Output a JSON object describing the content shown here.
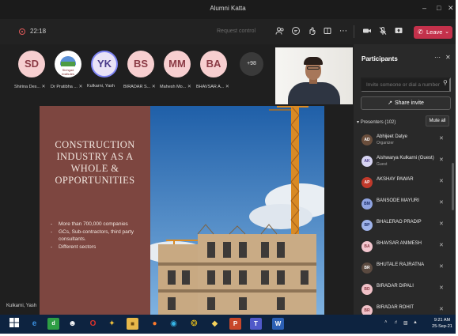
{
  "window": {
    "title": "Alumni Katta"
  },
  "toolbar": {
    "timer": "22:18",
    "request_control": "Request control",
    "leave_label": "Leave"
  },
  "strip": {
    "tiles": [
      {
        "initials": "SD",
        "name": "Shirina Des..."
      },
      {
        "initials": "",
        "logo_text": "Sinhgad Institutes",
        "name": "Dr Pratibha ..."
      },
      {
        "initials": "YK",
        "name": "Kulkarni, Yash"
      },
      {
        "initials": "BS",
        "name": "BIRADAR S..."
      },
      {
        "initials": "MM",
        "name": "Mahesh Mo..."
      },
      {
        "initials": "BA",
        "name": "BHAVSAR A..."
      }
    ],
    "more_count": "+98"
  },
  "slide": {
    "heading": "CONSTRUCTION INDUSTRY AS A WHOLE & OPPORTUNITIES",
    "bullets": [
      "More than 700,000 companies",
      "GCs, Sub-contractors,  third party consultants.",
      "Different sectors"
    ],
    "presenter_name": "Kulkarni, Yash"
  },
  "panel": {
    "title": "Participants",
    "invite_placeholder": "Invite someone or dial a number",
    "share_invite": "Share invite",
    "presenters_label": "Presenters (102)",
    "mute_all": "Mute all",
    "people": [
      {
        "initials": "AD",
        "name": "Abhijeet Datye",
        "role": "Organizer"
      },
      {
        "initials": "AK",
        "name": "Aishwarya Kulkarni (Guest)",
        "role": "Guest"
      },
      {
        "initials": "AP",
        "name": "AKSHAY PAWAR",
        "role": ""
      },
      {
        "initials": "BM",
        "name": "BANSODE MAYURI",
        "role": ""
      },
      {
        "initials": "BP",
        "name": "BHALERAO PRADIP",
        "role": ""
      },
      {
        "initials": "BA",
        "name": "BHAVSAR ANIMESH",
        "role": ""
      },
      {
        "initials": "BR",
        "name": "BHUTALE RAJRATNA",
        "role": ""
      },
      {
        "initials": "BD",
        "name": "BIRADAR DIPALI",
        "role": ""
      },
      {
        "initials": "BR",
        "name": "BIRADAR ROHIT",
        "role": ""
      }
    ]
  },
  "taskbar": {
    "time": "9:21 AM",
    "date": "25-Sep-21"
  },
  "colors": {
    "leave": "#c4314b",
    "slide_left": "#7d4640",
    "taskbar": "#0d2340",
    "panel_bg": "#292929"
  }
}
